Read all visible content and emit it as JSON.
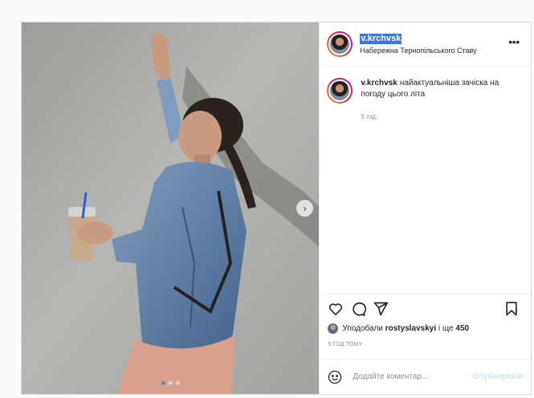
{
  "post": {
    "username": "v.krchvsk",
    "location": "Набережна Тернопільського Ставу",
    "more_icon": "more-horizontal-icon",
    "caption_text": "найактуальніша зачіска на погоду цього літа",
    "caption_time": "5 год.",
    "likes_prefix": "Уподобали",
    "likes_user": "rostyslavskyi",
    "likes_mid": "і ще",
    "likes_count": "450",
    "time_ago": "5 ГОД ТОМУ",
    "carousel": {
      "total": 3,
      "active": 1
    }
  },
  "actions": {
    "like_icon": "heart-icon",
    "comment_icon": "comment-icon",
    "share_icon": "paper-plane-icon",
    "save_icon": "bookmark-icon"
  },
  "comment_form": {
    "placeholder": "Додайте коментар...",
    "publish_label": "Опублікувати",
    "emoji_icon": "emoji-icon"
  },
  "colors": {
    "accent_blue": "#3897f0",
    "selection": "#3a78d8",
    "publish_disabled": "#b2dffc",
    "border": "#dbdbdb"
  }
}
